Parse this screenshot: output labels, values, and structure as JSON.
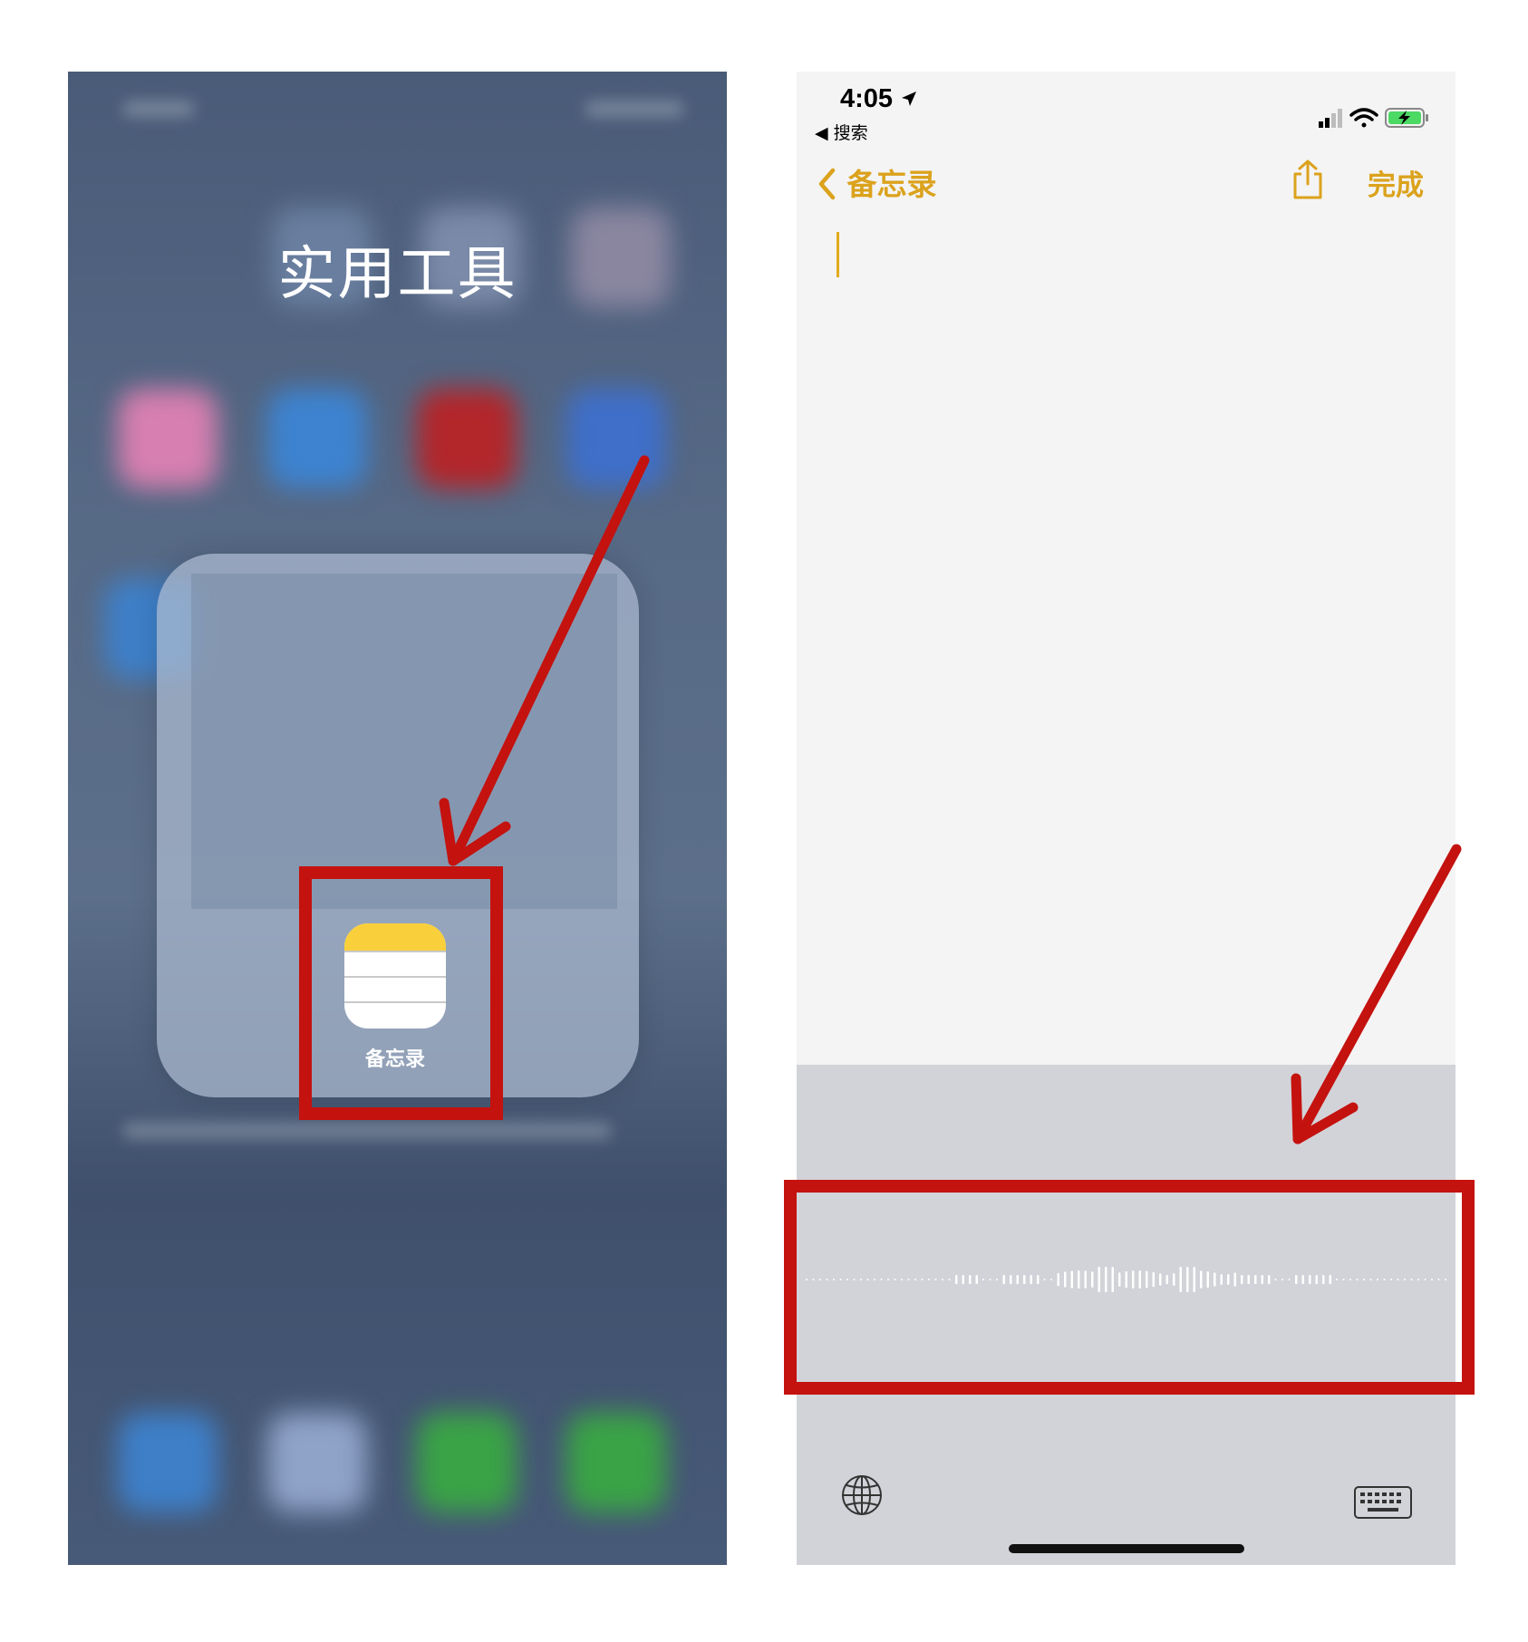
{
  "left_screen": {
    "folder_title": "实用工具",
    "app_label": "备忘录",
    "app_icon": "notes-app-icon"
  },
  "right_screen": {
    "status_time": "4:05",
    "status_back": "◀ 搜索",
    "nav_back_label": "备忘录",
    "nav_done_label": "完成",
    "icons": [
      "location-arrow-icon",
      "cellular-signal-icon",
      "wifi-icon",
      "battery-charging-icon",
      "share-icon",
      "globe-icon",
      "keyboard-icon"
    ]
  },
  "colors": {
    "accent": "#dba21c",
    "annotation_red": "#c4120f",
    "keyboard_bg": "#d2d3d8"
  }
}
